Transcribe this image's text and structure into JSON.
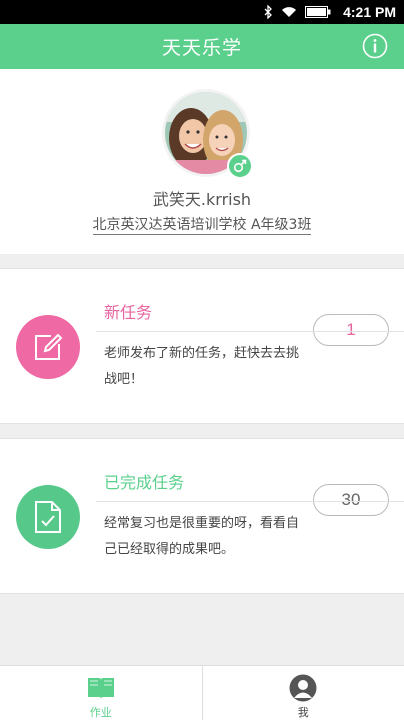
{
  "status_bar": {
    "time": "4:21 PM",
    "icons": [
      "bluetooth-icon",
      "wifi-icon",
      "battery-icon"
    ]
  },
  "app_bar": {
    "title": "天天乐学",
    "info_icon": "info-icon"
  },
  "profile": {
    "name": "武笑天.krrish",
    "school_class": "北京英汉达英语培训学校 A年级3班",
    "gender_icon": "male-icon"
  },
  "tasks": [
    {
      "title": "新任务",
      "description": "老师发布了新的任务，赶快去去挑战吧！",
      "count": "1",
      "icon": "edit-icon",
      "color": "#e9649f"
    },
    {
      "title": "已完成任务",
      "description": "经常复习也是很重要的呀，看看自己已经取得的成果吧。",
      "count": "30",
      "icon": "document-check-icon",
      "color": "#5bd08c"
    }
  ],
  "bottom_nav": [
    {
      "label": "作业",
      "icon": "book-icon",
      "active": true
    },
    {
      "label": "我",
      "icon": "person-icon",
      "active": false
    }
  ],
  "colors": {
    "primary": "#5bd08c",
    "accent": "#e9649f"
  }
}
